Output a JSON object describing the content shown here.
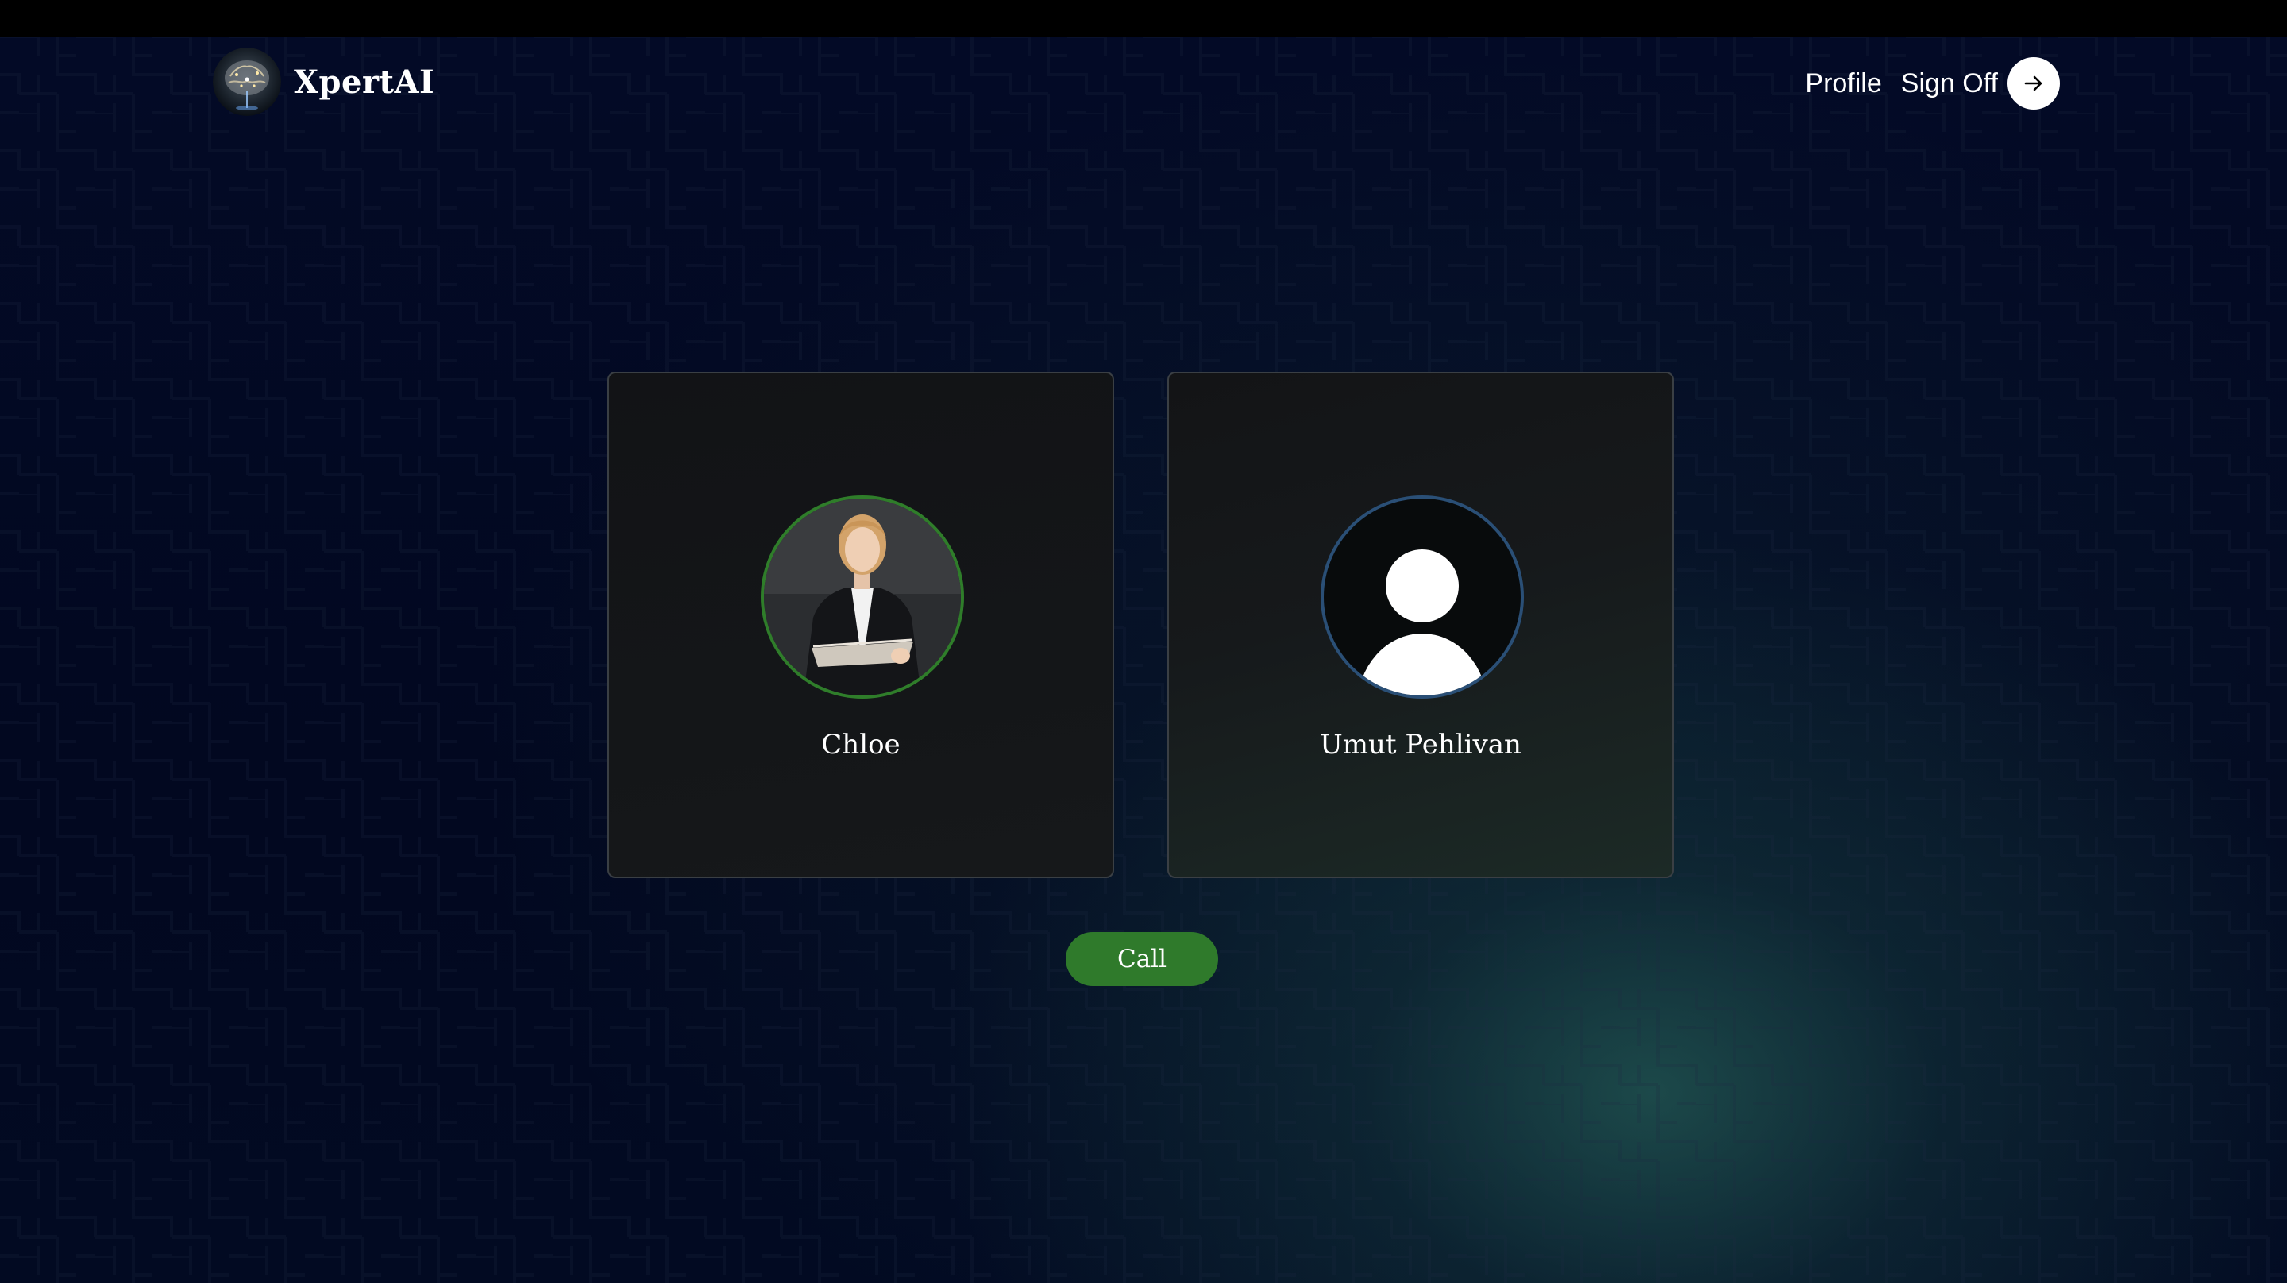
{
  "app": {
    "name": "XpertAI",
    "logo_icon": "brain-globe-icon"
  },
  "nav": {
    "profile_label": "Profile",
    "signoff_label": "Sign Off",
    "signoff_icon": "arrow-right-icon"
  },
  "participants": [
    {
      "name": "Chloe",
      "avatar": "photo",
      "ring_color": "#2f7d2a"
    },
    {
      "name": "Umut Pehlivan",
      "avatar": "default-user-icon",
      "ring_color": "#2a4f76"
    }
  ],
  "actions": {
    "call_label": "Call",
    "call_color": "#2f7a2b"
  },
  "theme": {
    "background": "#030a26",
    "glow": "#245c56"
  }
}
